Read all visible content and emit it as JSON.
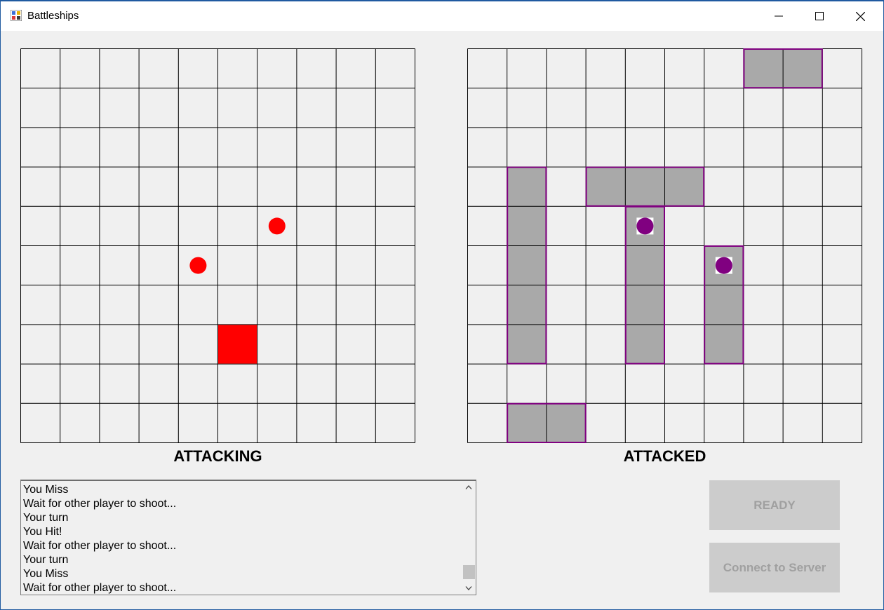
{
  "window": {
    "title": "Battleships"
  },
  "boards": {
    "attacking": {
      "caption": "ATTACKING",
      "rows": 10,
      "cols": 10,
      "misses": [
        [
          4,
          6
        ],
        [
          5,
          4
        ]
      ],
      "hits": [
        [
          7,
          5
        ]
      ]
    },
    "attacked": {
      "caption": "ATTACKED",
      "rows": 10,
      "cols": 10,
      "ships": [
        {
          "row": 0,
          "col": 7,
          "length": 2,
          "orientation": "horizontal"
        },
        {
          "row": 3,
          "col": 1,
          "length": 5,
          "orientation": "vertical"
        },
        {
          "row": 3,
          "col": 3,
          "length": 3,
          "orientation": "horizontal"
        },
        {
          "row": 4,
          "col": 4,
          "length": 4,
          "orientation": "vertical"
        },
        {
          "row": 5,
          "col": 6,
          "length": 3,
          "orientation": "vertical"
        },
        {
          "row": 9,
          "col": 1,
          "length": 2,
          "orientation": "horizontal"
        }
      ],
      "hits": [
        [
          4,
          4
        ],
        [
          5,
          6
        ]
      ]
    }
  },
  "colors": {
    "grid_line": "#000000",
    "miss": "#ff0000",
    "hit_square": "#ff0000",
    "ship_fill": "#a9a9a9",
    "ship_border": "#800080",
    "enemy_hit": "#800080"
  },
  "log": {
    "lines": [
      "You Miss",
      "Wait for other player to shoot...",
      "Your turn",
      "You Hit!",
      "Wait for other player to shoot...",
      "Your turn",
      "You Miss",
      "Wait for other player to shoot..."
    ]
  },
  "buttons": {
    "ready": "READY",
    "connect": "Connect to Server"
  },
  "icons": {
    "app": "battleships-app-icon",
    "minimize": "minimize-icon",
    "maximize": "maximize-icon",
    "close": "close-icon",
    "scroll_up": "chevron-up-icon",
    "scroll_down": "chevron-down-icon"
  }
}
